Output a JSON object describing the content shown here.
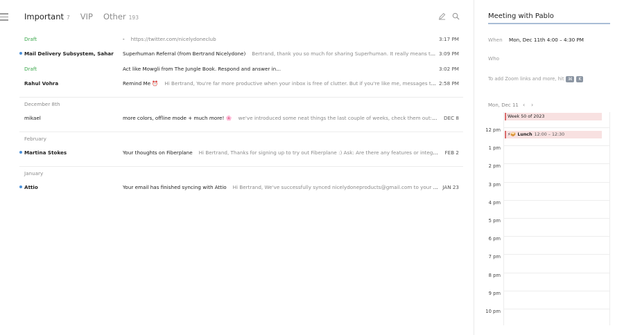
{
  "tabs": [
    {
      "label": "Important",
      "count": "7"
    },
    {
      "label": "VIP",
      "count": ""
    },
    {
      "label": "Other",
      "count": "193"
    }
  ],
  "rows": [
    {
      "sender": "Draft",
      "subject": "-",
      "preview": "https://twitter.com/nicelydoneclub",
      "time": "3:17 PM"
    },
    {
      "sender": "Mail Delivery Subsystem, Sahar",
      "subject": "Superhuman Referral (from Bertrand Nicelydone)",
      "preview": "Bertrand, thank you so much for sharing Superhuman. It really means the world to us. Sahar has been added to",
      "time": "3:09 PM"
    },
    {
      "sender": "Draft",
      "subject": "Act like Mowgli from The Jungle Book. Respond and answer in...",
      "preview": "",
      "time": "3:02 PM"
    },
    {
      "sender": "Rahul Vohra",
      "subject": "Remind Me ⏰",
      "preview": "Hi Bertrand, You're far more productive when your inbox is free of clutter. But if you're like me, messages tend to",
      "time": "2:58 PM"
    },
    {
      "sender": "mikael",
      "subject": "more colors, offline mode + much more! 🌸",
      "preview": "we've introduced some neat things the last couple of weeks, check them out: 🎨 more colors - we've added",
      "time": "DEC 8"
    },
    {
      "sender": "Martina Stokes",
      "subject": "Your thoughts on Fiberplane",
      "preview": "Hi Bertrand, Thanks for signing up to try out Fiberplane :) Ask: Are there any features or integrations you're mo",
      "time": "FEB 2"
    },
    {
      "sender": "Attio",
      "subject": "Your email has finished syncing with Attio",
      "preview": "Hi Bertrand, We've successfully synced nicelydoneproducts@gmail.com to your Nicelydone workspace",
      "time": "JAN 23"
    }
  ],
  "sections": [
    "December 8th",
    "February",
    "January"
  ],
  "calendar": {
    "title": "Meeting with Pablo",
    "when_label": "When",
    "when_value": "Mon, Dec 11th 4:00 – 4:30 PM",
    "who_label": "Who",
    "zoom_hint": "To add Zoom links and more, hit",
    "kbd1": "⌘",
    "kbd2": "K",
    "date_label": "Mon, Dec 11",
    "prev": "‹",
    "next": "›",
    "week_banner": "Week 50 of 2023",
    "lunch_title": "⚡🥪 Lunch",
    "lunch_time": "12:00 – 12:30",
    "hours": [
      "12 pm",
      "1 pm",
      "2 pm",
      "3 pm",
      "4 pm",
      "5 pm",
      "6 pm",
      "7 pm",
      "8 pm",
      "9 pm",
      "10 pm"
    ]
  },
  "colors": {
    "draft": "#3aa84b",
    "unread": "#4a90d9",
    "event": "#d96b6b"
  }
}
